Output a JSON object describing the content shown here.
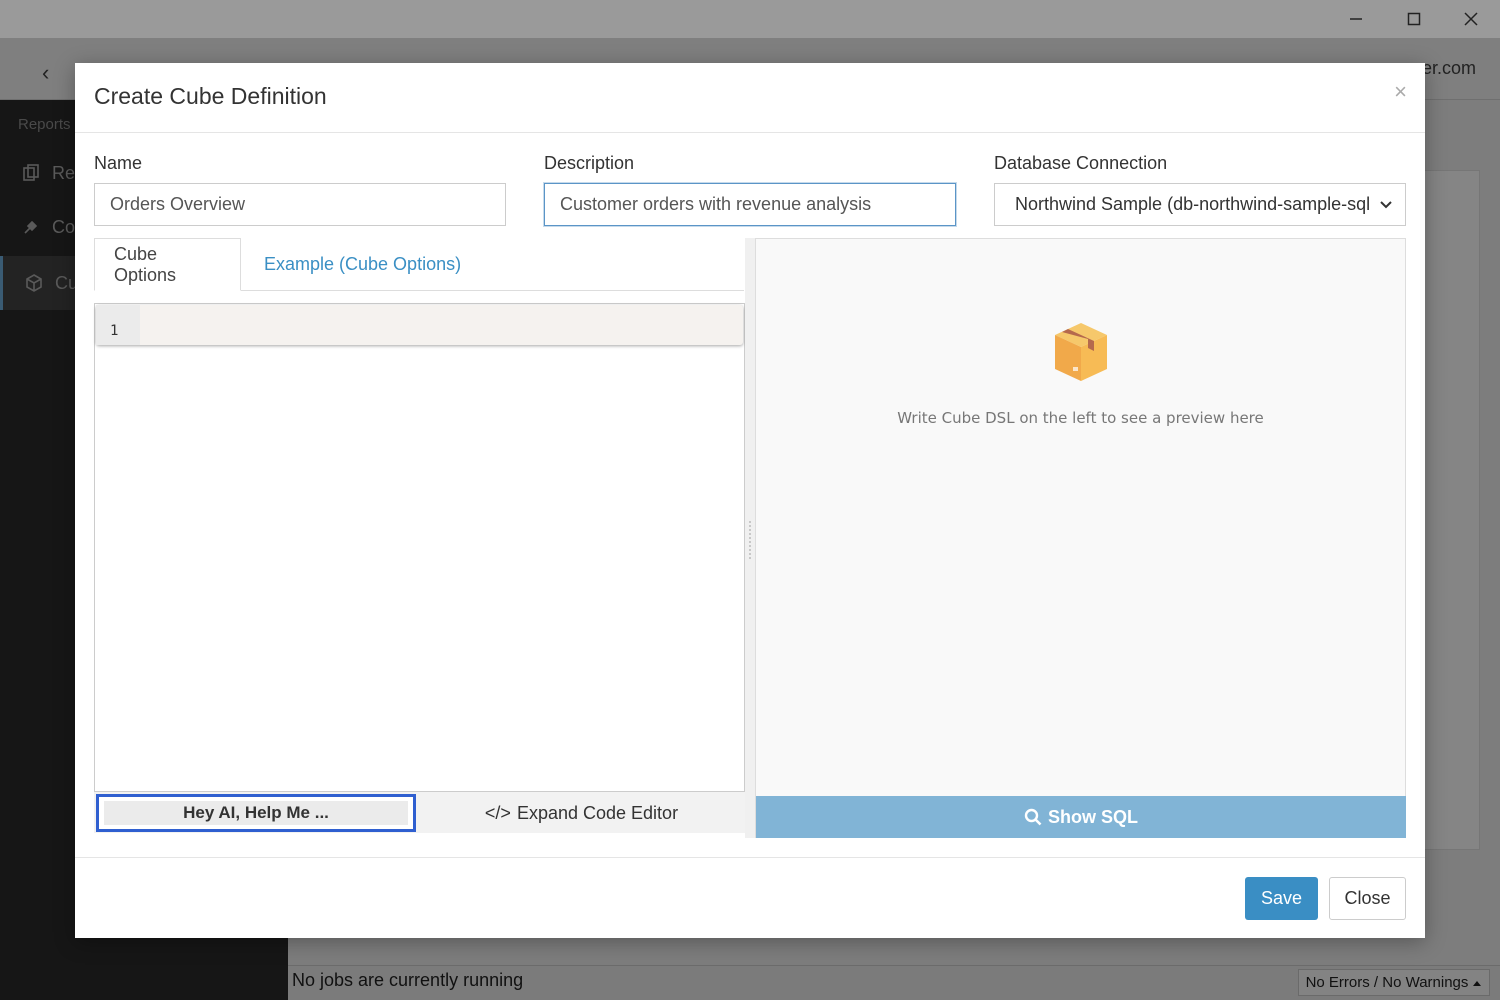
{
  "window": {
    "minimize_icon": "minimize-icon",
    "maximize_icon": "maximize-icon",
    "close_icon": "close-icon"
  },
  "background_app": {
    "header_email_fragment": "er.com",
    "sidebar": {
      "group_label": "Reports",
      "items": [
        {
          "label": "Re",
          "icon": "reports-icon"
        },
        {
          "label": "Co",
          "icon": "plug-icon"
        },
        {
          "label": "Cu",
          "icon": "cube-icon"
        }
      ]
    },
    "status_text": "No jobs are currently running",
    "status_badge": "No Errors / No Warnings"
  },
  "modal": {
    "title": "Create Cube Definition",
    "close_symbol": "×",
    "fields": {
      "name_label": "Name",
      "name_value": "Orders Overview",
      "description_label": "Description",
      "description_value": "Customer orders with revenue analysis",
      "connection_label": "Database Connection",
      "connection_value": "Northwind Sample (db-northwind-sample-sqlite)"
    },
    "tabs": [
      {
        "label": "Cube Options",
        "active": true
      },
      {
        "label": "Example (Cube Options)",
        "active": false
      }
    ],
    "editor": {
      "line_number": "1",
      "ai_button": "Hey AI, Help Me ...",
      "expand_button": "Expand Code Editor",
      "expand_icon": "</>"
    },
    "preview": {
      "icon": "package-icon",
      "empty_text": "Write Cube DSL on the left to see a preview here",
      "show_sql_button": "Show SQL"
    },
    "footer": {
      "save_button": "Save",
      "close_button": "Close"
    }
  },
  "colors": {
    "primary": "#3a8ec4",
    "show_sql_bg": "#81b4d6",
    "focus_ring": "#2f5fd0",
    "link": "#3a8fc4"
  }
}
